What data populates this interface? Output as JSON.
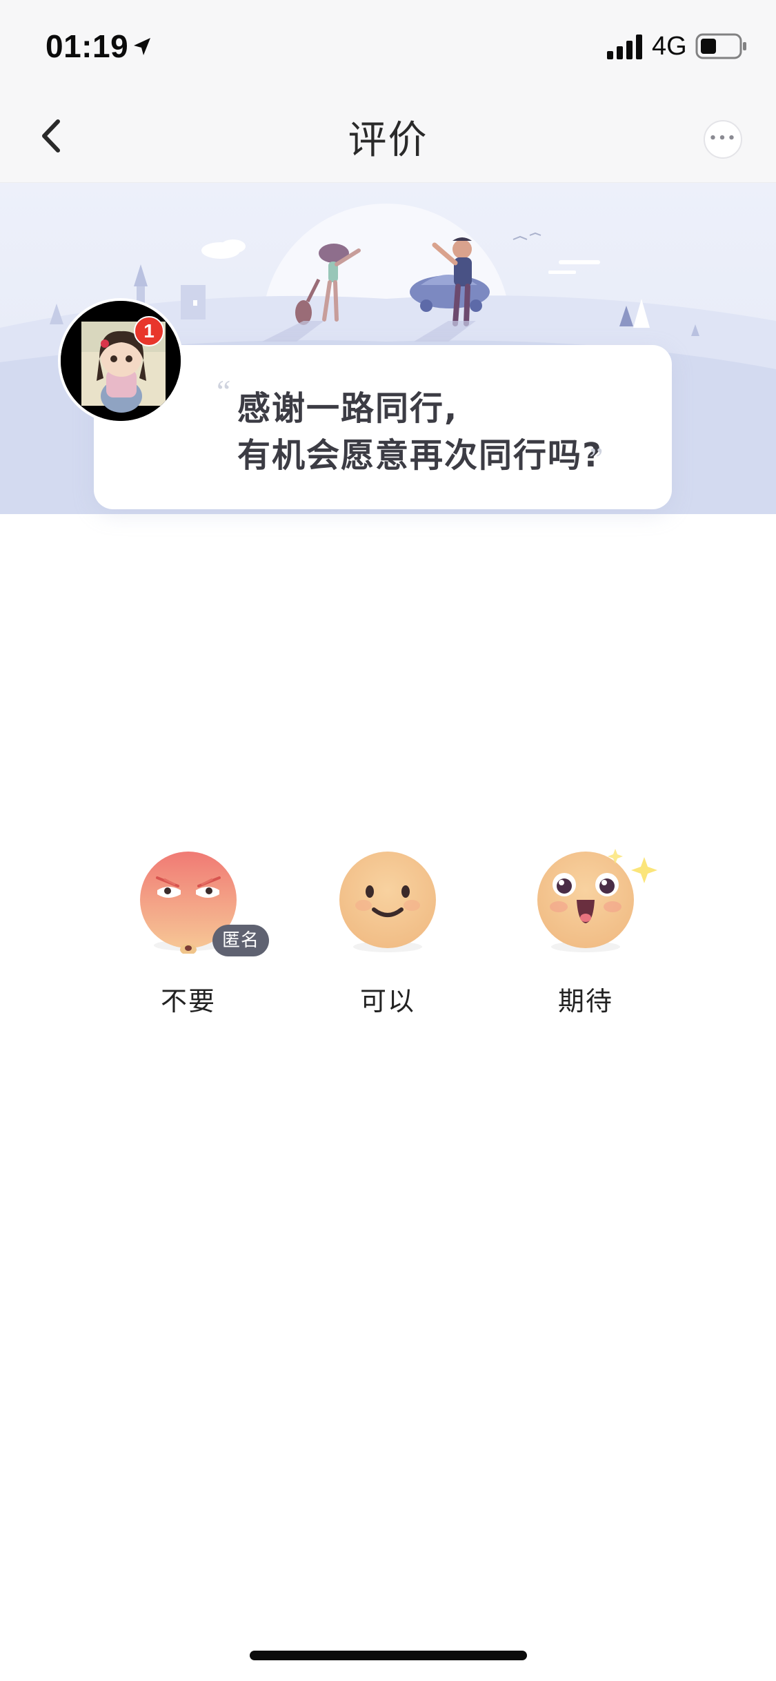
{
  "status_bar": {
    "time": "01:19",
    "network": "4G",
    "icons": [
      "location-arrow-icon",
      "signal-icon",
      "battery-icon"
    ]
  },
  "nav": {
    "title": "评价",
    "icons": [
      "back-chevron-icon",
      "more-dots-icon"
    ]
  },
  "driver_card": {
    "badge_count": "1",
    "quote_open": "“",
    "quote_line_1": "感谢一路同行,",
    "quote_line_2": "有机会愿意再次同行吗?",
    "quote_close": "”"
  },
  "rating": {
    "options": [
      {
        "label": "不要",
        "icon": "angry-face-icon"
      },
      {
        "label": "可以",
        "icon": "smile-face-icon"
      },
      {
        "label": "期待",
        "icon": "excited-face-icon"
      }
    ],
    "anonymous_badge": "匿名"
  },
  "colors": {
    "banner_bg": "#e8ecf8",
    "text_primary": "#3c3c44",
    "badge_red": "#e8362b",
    "anon_badge_bg": "#5f6271",
    "face_peach": "#f5c48d",
    "face_angry": "#f1877d"
  }
}
